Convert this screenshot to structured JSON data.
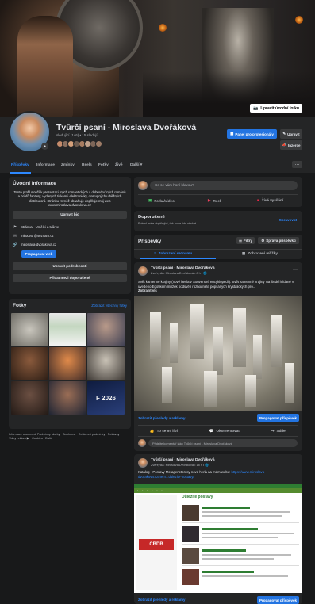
{
  "cover": {
    "edit_cover_label": "Upravit úvodní fotku"
  },
  "page": {
    "title": "Tvůrčí psaní - Miroslava Dvořáková",
    "stats": "sledující (146) • 15 sledují"
  },
  "header_buttons": {
    "professional_panel": "Panel pro profesionály",
    "edit": "Upravit",
    "promote": "Inzerce"
  },
  "tabs": [
    "Příspěvky",
    "Informace",
    "Zmínky",
    "Reels",
    "Fotky",
    "Živé",
    "Další ▾"
  ],
  "intro": {
    "title": "Úvodní informace",
    "text": "Tento profil slouží k prezentaci mých romantických a dobrodružných románů a briefů fantasy, vydaných tiskem i elektronicky, dostupných u běžných distributorů. Stránku rovněž obsahuje doplňuje můj web",
    "link": "www.miroslava-dvorakova.cz",
    "edit_bio": "Upravit bio",
    "category": "Stránka · Umělci a tvůrce",
    "email": "mirodvor@seznam.cz",
    "website": "miroslava-dvorakova.cz",
    "promote_web": "Propagovat web",
    "edit_details": "Upravit podrobnosti",
    "add_featured": "Přidat mezi doporučené"
  },
  "photos": {
    "title": "Fotky",
    "see_all": "Zobrazit všechny fotky",
    "year_label": "F 2026"
  },
  "footer": "Informace o ochraně Podmínky služby · Souhrnné · Reklamní podmínky · Reklamy · Volby reklam ▶ · Cookies · Další",
  "composer": {
    "placeholder": "Co se vám honí hlavou?",
    "photo_video": "Fotka/video",
    "reel": "Reel",
    "live": "Živé vysílání"
  },
  "featured": {
    "title": "Doporučené",
    "subtitle": "Pokud máte doplňující, tak bude lidé stiskat.",
    "manage": "Spravovat"
  },
  "posts_header": {
    "title": "Příspěvky",
    "filters": "Filtry",
    "manage_posts": "Správa příspěvků",
    "list_view": "Zobrazení seznamu",
    "grid_view": "Zobrazení mřížky"
  },
  "post1": {
    "author": "Tvůrčí psaní - Miroslava Dvořáková",
    "meta": "Zveřejnila: Miroslava Dvořáková • 8 h • 🌐",
    "body": "Svět kamenné krajiny (nové hesla v Souvenuré encyklopedii): Svět kamenné krajiny Na Šedé hlídané v uvedeno Egotikem mřížek podsvětí rozhodněte popsaných krystalických pro...",
    "more": "Zobrazit víc",
    "insights": "Zobrazit přehledy a reklamy",
    "boost": "Propagovat příspěvek",
    "like": "To se mi líbí",
    "comment": "Okomentovat",
    "share": "Sdílet",
    "comment_placeholder": "Přidejte komentář jako Tvůrčí psaní - Miroslava Dvořáková"
  },
  "post2": {
    "author": "Tvůrčí psaní - Miroslava Dvořáková",
    "meta": "Zveřejnila: Miroslava Dvořáková • 18 h • 🌐",
    "body_prefix": "Katalog - Postavy Metagenetorusy nové herla na mém webu:",
    "link": "https://www.miroslava-dvorakova.cz/nem...dulezite-postavy/",
    "site_title": "Důležité postavy",
    "site_logo": "CBDB",
    "insights": "Zobrazit přehledy a reklamy",
    "boost": "Propagovat příspěvek"
  }
}
